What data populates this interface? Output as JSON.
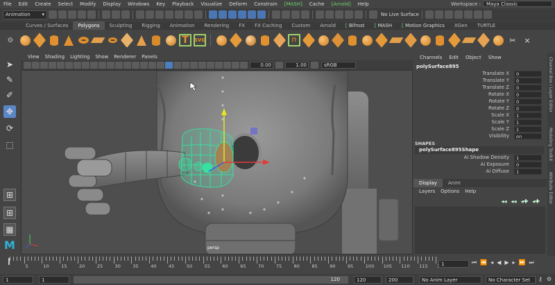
{
  "menubar": {
    "items": [
      "File",
      "Edit",
      "Create",
      "Select",
      "Modify",
      "Display",
      "Windows",
      "Key",
      "Playback",
      "Visualize",
      "Deform",
      "Constrain",
      "MASH",
      "Cache",
      "Arnold",
      "Help"
    ],
    "workspace_label": "Workspace :",
    "workspace_value": "Maya Classic"
  },
  "statusline": {
    "mode": "Animation",
    "live_surface": "No Live Surface"
  },
  "shelf_tabs": [
    "Curves / Surfaces",
    "Polygons",
    "Sculpting",
    "Rigging",
    "Animation",
    "Rendering",
    "FX",
    "FX Caching",
    "Custom",
    "Arnold",
    "Bifrost",
    "MASH",
    "Motion Graphics",
    "XGen",
    "TURTLE"
  ],
  "shelf_active": "Polygons",
  "viewport": {
    "menu": [
      "View",
      "Shading",
      "Lighting",
      "Show",
      "Renderer",
      "Panels"
    ],
    "field_a": "0.00",
    "field_b": "1.00",
    "color_space": "sRGB gamma",
    "camera_label": "persp"
  },
  "channel_box": {
    "menu": [
      "Channels",
      "Edit",
      "Object",
      "Show"
    ],
    "object_name": "polySurface895",
    "attributes": [
      {
        "label": "Translate X",
        "value": "0"
      },
      {
        "label": "Translate Y",
        "value": "0"
      },
      {
        "label": "Translate Z",
        "value": "0"
      },
      {
        "label": "Rotate X",
        "value": "0"
      },
      {
        "label": "Rotate Y",
        "value": "0"
      },
      {
        "label": "Rotate Z",
        "value": "0"
      },
      {
        "label": "Scale X",
        "value": "1"
      },
      {
        "label": "Scale Y",
        "value": "1"
      },
      {
        "label": "Scale Z",
        "value": "1"
      },
      {
        "label": "Visibility",
        "value": "on"
      }
    ],
    "shapes_title": "SHAPES",
    "shape_name": "polySurface895Shape",
    "shape_attributes": [
      {
        "label": "Ai Shadow Density",
        "value": "1"
      },
      {
        "label": "Ai Exposure",
        "value": "0"
      },
      {
        "label": "Ai Diffuse",
        "value": "1"
      }
    ],
    "side_tabs": [
      "Channel Box / Layer Editor",
      "Modeling Toolkit",
      "Attribute Editor"
    ]
  },
  "layer_editor": {
    "tabs": [
      "Display",
      "Anim"
    ],
    "active_tab": "Display",
    "menu": [
      "Layers",
      "Options",
      "Help"
    ]
  },
  "timeslider": {
    "labels": [
      "5",
      "10",
      "15",
      "20",
      "25",
      "30",
      "35",
      "40",
      "45",
      "50",
      "55",
      "60",
      "65",
      "70",
      "75",
      "80",
      "85",
      "90",
      "95",
      "100",
      "105",
      "110",
      "115",
      "120"
    ],
    "current_frame": "1"
  },
  "range": {
    "start": "1",
    "start_inner": "1",
    "range_label": "120",
    "end_inner": "120",
    "end": "200",
    "anim_layer": "No Anim Layer",
    "character_set": "No Character Set"
  },
  "colors": {
    "accent": "#5b87c7",
    "selection_green": "#38e0a0",
    "maya_icon": "#2fb4d8"
  }
}
